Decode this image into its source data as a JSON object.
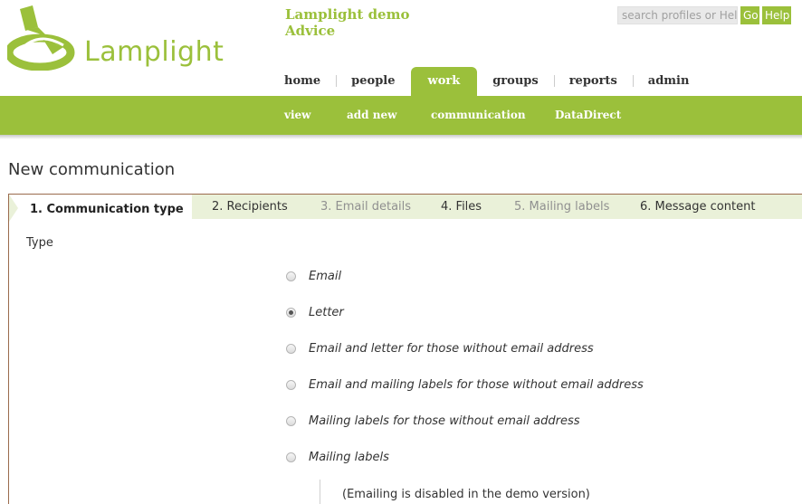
{
  "header": {
    "logo_text": "Lamplight",
    "site_title_line1": "Lamplight demo",
    "site_title_line2": "Advice",
    "search_placeholder": "search profiles or Help",
    "go_label": "Go",
    "help_label": "Help"
  },
  "main_nav": [
    "home",
    "people",
    "work",
    "groups",
    "reports",
    "admin"
  ],
  "main_nav_active": "work",
  "sub_nav": [
    "view",
    "add new",
    "communication",
    "DataDirect"
  ],
  "page_title": "New communication",
  "wizard": {
    "steps": [
      {
        "label": "1. Communication type",
        "state": "current"
      },
      {
        "label": "2. Recipients",
        "state": "enabled"
      },
      {
        "label": "3. Email details",
        "state": "disabled"
      },
      {
        "label": "4. Files",
        "state": "enabled"
      },
      {
        "label": "5. Mailing labels",
        "state": "disabled"
      },
      {
        "label": "6. Message content",
        "state": "enabled"
      }
    ],
    "type_label": "Type",
    "options": [
      {
        "label": "Email",
        "checked": false
      },
      {
        "label": "Letter",
        "checked": true
      },
      {
        "label": "Email and letter for those without email address",
        "checked": false
      },
      {
        "label": "Email and mailing labels for those without email address",
        "checked": false
      },
      {
        "label": "Mailing labels for those without email address",
        "checked": false
      },
      {
        "label": "Mailing labels",
        "checked": false
      }
    ],
    "note": "(Emailing is disabled in the demo version)"
  },
  "colors": {
    "brand_green": "#9bc03b",
    "steps_bg": "#eaf1d9",
    "frame_border": "#9b6b4d"
  }
}
